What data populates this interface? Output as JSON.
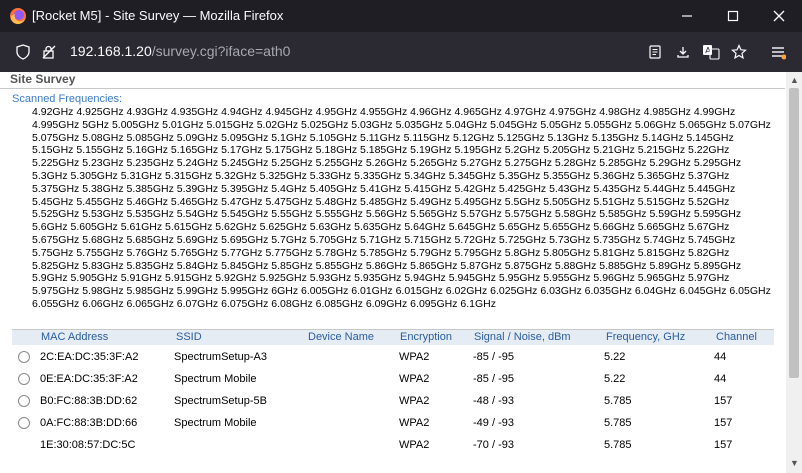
{
  "window": {
    "title": "[Rocket M5] - Site Survey — Mozilla Firefox",
    "url_host": "192.168.1.20",
    "url_path": "/survey.cgi?iface=ath0"
  },
  "page": {
    "title": "Site Survey",
    "scanned_label": "Scanned Frequencies:",
    "frequencies": "4.92GHz 4.925GHz 4.93GHz 4.935GHz 4.94GHz 4.945GHz 4.95GHz 4.955GHz 4.96GHz 4.965GHz 4.97GHz 4.975GHz 4.98GHz 4.985GHz 4.99GHz 4.995GHz 5GHz 5.005GHz 5.01GHz 5.015GHz 5.02GHz 5.025GHz 5.03GHz 5.035GHz 5.04GHz 5.045GHz 5.05GHz 5.055GHz 5.06GHz 5.065GHz 5.07GHz 5.075GHz 5.08GHz 5.085GHz 5.09GHz 5.095GHz 5.1GHz 5.105GHz 5.11GHz 5.115GHz 5.12GHz 5.125GHz 5.13GHz 5.135GHz 5.14GHz 5.145GHz 5.15GHz 5.155GHz 5.16GHz 5.165GHz 5.17GHz 5.175GHz 5.18GHz 5.185GHz 5.19GHz 5.195GHz 5.2GHz 5.205GHz 5.21GHz 5.215GHz 5.22GHz 5.225GHz 5.23GHz 5.235GHz 5.24GHz 5.245GHz 5.25GHz 5.255GHz 5.26GHz 5.265GHz 5.27GHz 5.275GHz 5.28GHz 5.285GHz 5.29GHz 5.295GHz 5.3GHz 5.305GHz 5.31GHz 5.315GHz 5.32GHz 5.325GHz 5.33GHz 5.335GHz 5.34GHz 5.345GHz 5.35GHz 5.355GHz 5.36GHz 5.365GHz 5.37GHz 5.375GHz 5.38GHz 5.385GHz 5.39GHz 5.395GHz 5.4GHz 5.405GHz 5.41GHz 5.415GHz 5.42GHz 5.425GHz 5.43GHz 5.435GHz 5.44GHz 5.445GHz 5.45GHz 5.455GHz 5.46GHz 5.465GHz 5.47GHz 5.475GHz 5.48GHz 5.485GHz 5.49GHz 5.495GHz 5.5GHz 5.505GHz 5.51GHz 5.515GHz 5.52GHz 5.525GHz 5.53GHz 5.535GHz 5.54GHz 5.545GHz 5.55GHz 5.555GHz 5.56GHz 5.565GHz 5.57GHz 5.575GHz 5.58GHz 5.585GHz 5.59GHz 5.595GHz 5.6GHz 5.605GHz 5.61GHz 5.615GHz 5.62GHz 5.625GHz 5.63GHz 5.635GHz 5.64GHz 5.645GHz 5.65GHz 5.655GHz 5.66GHz 5.665GHz 5.67GHz 5.675GHz 5.68GHz 5.685GHz 5.69GHz 5.695GHz 5.7GHz 5.705GHz 5.71GHz 5.715GHz 5.72GHz 5.725GHz 5.73GHz 5.735GHz 5.74GHz 5.745GHz 5.75GHz 5.755GHz 5.76GHz 5.765GHz 5.77GHz 5.775GHz 5.78GHz 5.785GHz 5.79GHz 5.795GHz 5.8GHz 5.805GHz 5.81GHz 5.815GHz 5.82GHz 5.825GHz 5.83GHz 5.835GHz 5.84GHz 5.845GHz 5.85GHz 5.855GHz 5.86GHz 5.865GHz 5.87GHz 5.875GHz 5.88GHz 5.885GHz 5.89GHz 5.895GHz 5.9GHz 5.905GHz 5.91GHz 5.915GHz 5.92GHz 5.925GHz 5.93GHz 5.935GHz 5.94GHz 5.945GHz 5.95GHz 5.955GHz 5.96GHz 5.965GHz 5.97GHz 5.975GHz 5.98GHz 5.985GHz 5.99GHz 5.995GHz 6GHz 6.005GHz 6.01GHz 6.015GHz 6.02GHz 6.025GHz 6.03GHz 6.035GHz 6.04GHz 6.045GHz 6.05GHz 6.055GHz 6.06GHz 6.065GHz 6.07GHz 6.075GHz 6.08GHz 6.085GHz 6.09GHz 6.095GHz 6.1GHz"
  },
  "table": {
    "headers": {
      "mac": "MAC Address",
      "ssid": "SSID",
      "device": "Device Name",
      "enc": "Encryption",
      "signal": "Signal / Noise, dBm",
      "freq": "Frequency, GHz",
      "channel": "Channel"
    },
    "rows": [
      {
        "mac": "2C:EA:DC:35:3F:A2",
        "ssid": "SpectrumSetup-A3",
        "device": "",
        "enc": "WPA2",
        "signal": "-85 / -95",
        "freq": "5.22",
        "channel": "44"
      },
      {
        "mac": "0E:EA:DC:35:3F:A2",
        "ssid": "Spectrum Mobile",
        "device": "",
        "enc": "WPA2",
        "signal": "-85 / -95",
        "freq": "5.22",
        "channel": "44"
      },
      {
        "mac": "B0:FC:88:3B:DD:62",
        "ssid": "SpectrumSetup-5B",
        "device": "",
        "enc": "WPA2",
        "signal": "-48 / -93",
        "freq": "5.785",
        "channel": "157"
      },
      {
        "mac": "0A:FC:88:3B:DD:66",
        "ssid": "Spectrum Mobile",
        "device": "",
        "enc": "WPA2",
        "signal": "-49 / -93",
        "freq": "5.785",
        "channel": "157"
      },
      {
        "mac": "1E:30:08:57:DC:5C",
        "ssid": "",
        "device": "",
        "enc": "WPA2",
        "signal": "-70 / -93",
        "freq": "5.785",
        "channel": "157"
      }
    ]
  },
  "colors": {
    "titlebar": "#1f1e25",
    "toolbar": "#2b2a33",
    "accent_link": "#3a7bc8",
    "table_header_bg": "#e6ecf3"
  }
}
